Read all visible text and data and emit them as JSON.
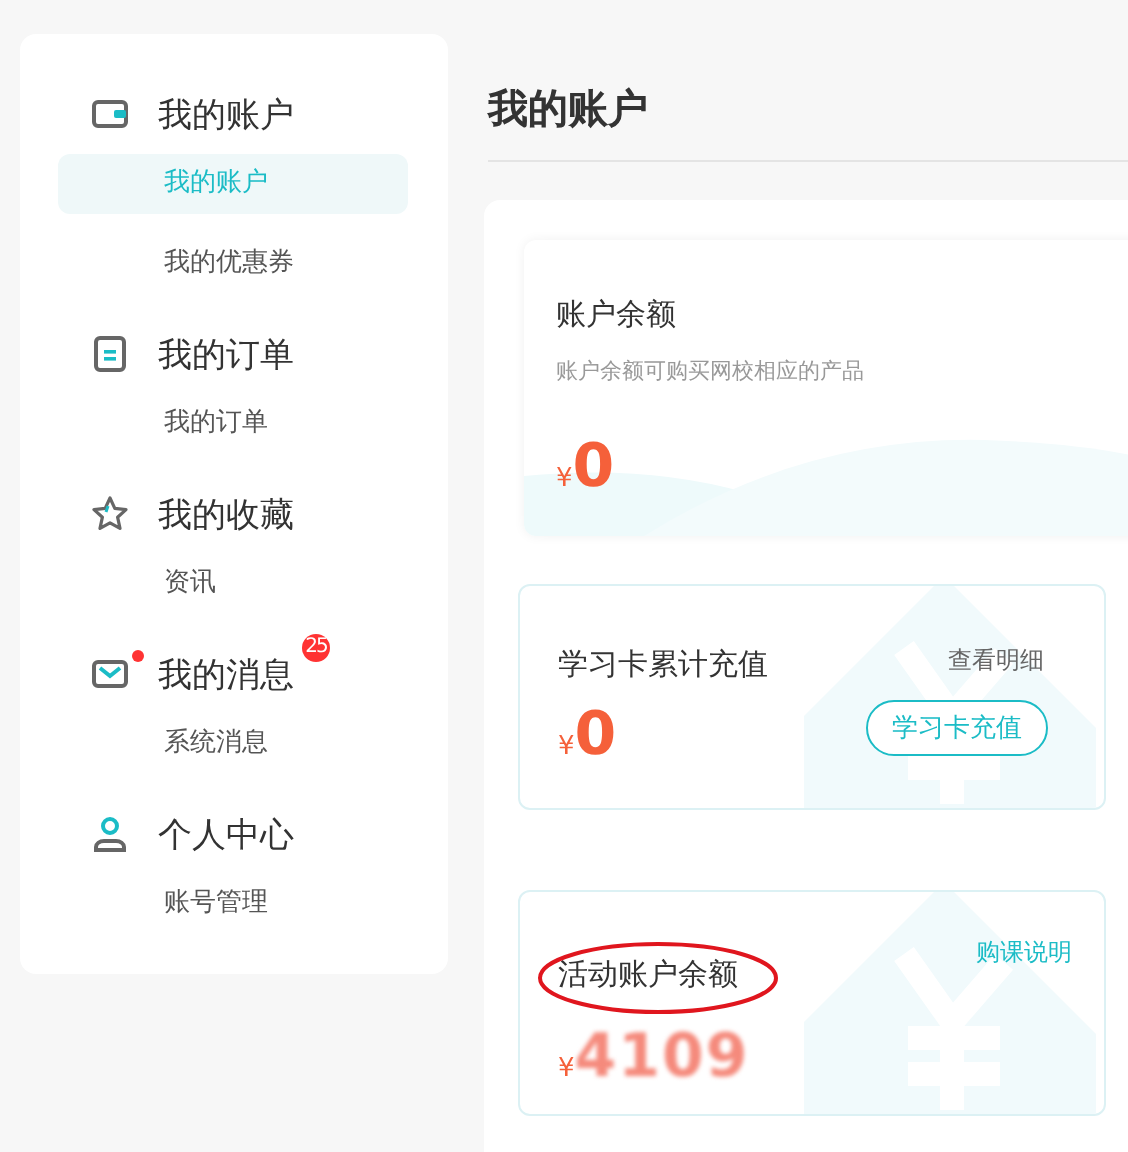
{
  "sidebar": {
    "groups": [
      {
        "kind": "wallet",
        "title": "我的账户",
        "items": [
          {
            "label": "我的账户",
            "selected": true
          },
          {
            "label": "我的优惠券",
            "selected": false
          }
        ]
      },
      {
        "kind": "order",
        "title": "我的订单",
        "items": [
          {
            "label": "我的订单",
            "selected": false
          }
        ]
      },
      {
        "kind": "star",
        "title": "我的收藏",
        "items": [
          {
            "label": "资讯",
            "selected": false
          }
        ]
      },
      {
        "kind": "mail",
        "title": "我的消息",
        "dot": true,
        "badge": "25",
        "items": [
          {
            "label": "系统消息",
            "selected": false
          }
        ]
      },
      {
        "kind": "person",
        "title": "个人中心",
        "items": [
          {
            "label": "账号管理",
            "selected": false
          }
        ]
      }
    ]
  },
  "page_title": "我的账户",
  "cards": [
    {
      "kind": "balance",
      "title": "账户余额",
      "description": "账户余额可购买网校相应的产品",
      "currency": "¥",
      "amount": "0"
    },
    {
      "kind": "study_card",
      "title": "学习卡累计充值",
      "link": "查看明细",
      "button": "学习卡充值",
      "currency": "¥",
      "amount": "0"
    },
    {
      "kind": "activity",
      "title": "活动账户余额",
      "link": "购课说明",
      "currency": "¥",
      "amount": "4109",
      "circled": true
    }
  ]
}
